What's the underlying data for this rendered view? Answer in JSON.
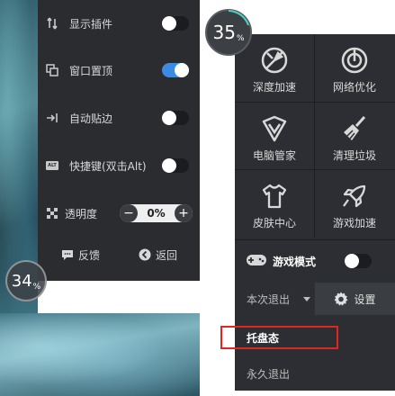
{
  "left_panel": {
    "settings": [
      {
        "label": "显示插件",
        "icon": "plugin-icon",
        "toggle": "off"
      },
      {
        "label": "窗口置顶",
        "icon": "window-top-icon",
        "toggle": "on"
      },
      {
        "label": "自动贴边",
        "icon": "snap-edge-icon",
        "toggle": "off"
      },
      {
        "label": "快捷键(双击Alt)",
        "icon": "alt-key-icon",
        "toggle": "off"
      }
    ],
    "opacity": {
      "label": "透明度",
      "value": "0%",
      "minus": "−",
      "plus": "+"
    },
    "alt_badge": "ALT",
    "feedback_label": "反馈",
    "back_label": "返回",
    "toggle_on_color": "#3b8be4"
  },
  "floating_ball_left": {
    "value": "34",
    "unit": "%"
  },
  "floating_ball_right": {
    "value": "35",
    "unit": "%",
    "accent": "#4ecdc4"
  },
  "menu": {
    "tiles": [
      {
        "label": "深度加速",
        "icon": "deep-accelerate-icon"
      },
      {
        "label": "网络优化",
        "icon": "network-optimize-icon"
      },
      {
        "label": "电脑管家",
        "icon": "shield-icon"
      },
      {
        "label": "清理垃圾",
        "icon": "broom-icon"
      },
      {
        "label": "皮肤中心",
        "icon": "tshirt-icon"
      },
      {
        "label": "游戏加速",
        "icon": "rocket-icon"
      }
    ],
    "game_mode": {
      "label": "游戏模式",
      "icon": "gamepad-icon",
      "toggle": "off"
    },
    "exit_select": {
      "label": "本次退出"
    },
    "settings_label": "设置",
    "exit_options": [
      {
        "label": "托盘态",
        "active": true
      },
      {
        "label": "永久退出",
        "active": false
      }
    ],
    "highlight_color": "#e0261f"
  }
}
